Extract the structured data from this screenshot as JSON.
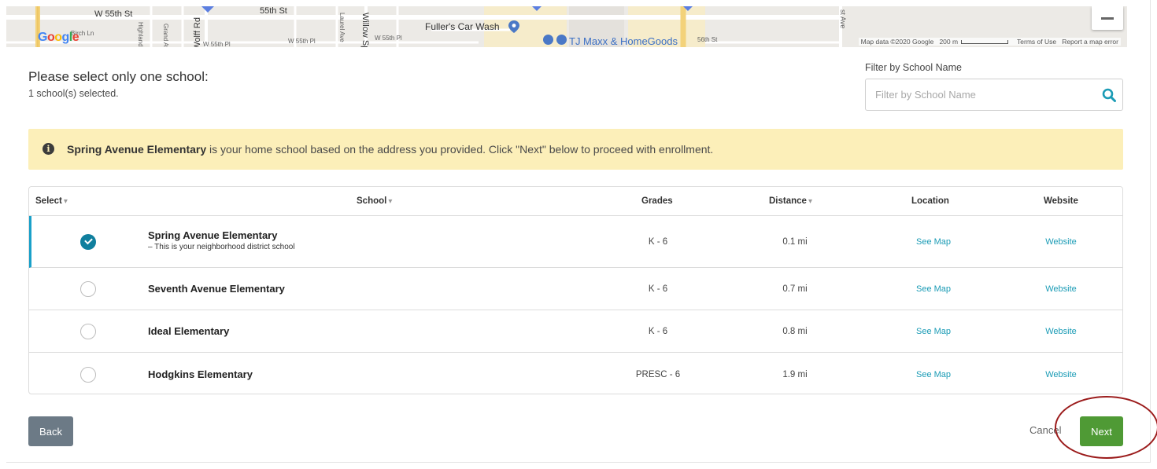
{
  "map": {
    "streets": {
      "w55th_st": "W 55th St",
      "w55th_st_2": "55th St",
      "birch_ln": "Birch Ln",
      "highland_dr": "Highland Dr",
      "grand_ave": "Grand Ave",
      "wolff_rd": "Wolff Rd",
      "w55th_pl_1": "W 55th Pl",
      "w55th_pl_2": "W 55th Pl",
      "w55th_pl_3": "W 55th Pl",
      "laurel_ave": "Laurel Ave",
      "willow_sp": "Willow Sp",
      "st_56th": "56th St",
      "east_ave": "st Ave"
    },
    "places": {
      "fullers": "Fuller's Car Wash",
      "tjmaxx": "TJ Maxx & HomeGoods"
    },
    "logo": "Google",
    "footer": {
      "data": "Map data ©2020 Google",
      "scale": "200 m",
      "terms": "Terms of Use",
      "report": "Report a map error"
    }
  },
  "header": {
    "prompt": "Please select only one school:",
    "selected_count": "1 school(s) selected."
  },
  "filter": {
    "label": "Filter by School Name",
    "placeholder": "Filter by School Name",
    "value": ""
  },
  "alert": {
    "school": "Spring Avenue Elementary",
    "message": " is your home school based on the address you provided. Click \"Next\" below to proceed with enrollment."
  },
  "table": {
    "headers": {
      "select": "Select",
      "school": "School",
      "grades": "Grades",
      "distance": "Distance",
      "location": "Location",
      "website": "Website"
    },
    "rows": [
      {
        "selected": true,
        "name": "Spring Avenue Elementary",
        "note": "– This is your neighborhood district school",
        "grades": "K - 6",
        "distance": "0.1 mi",
        "location": "See Map",
        "website": "Website"
      },
      {
        "selected": false,
        "name": "Seventh Avenue Elementary",
        "note": "",
        "grades": "K - 6",
        "distance": "0.7 mi",
        "location": "See Map",
        "website": "Website"
      },
      {
        "selected": false,
        "name": "Ideal Elementary",
        "note": "",
        "grades": "K - 6",
        "distance": "0.8 mi",
        "location": "See Map",
        "website": "Website"
      },
      {
        "selected": false,
        "name": "Hodgkins Elementary",
        "note": "",
        "grades": "PRESC - 6",
        "distance": "1.9 mi",
        "location": "See Map",
        "website": "Website"
      }
    ]
  },
  "buttons": {
    "back": "Back",
    "cancel": "Cancel",
    "next": "Next"
  },
  "colors": {
    "alert_bg": "#fcefb9",
    "accent": "#1aa0c9",
    "next": "#4f9a35",
    "back": "#6c7a86",
    "annotation": "#9b1b1b"
  }
}
